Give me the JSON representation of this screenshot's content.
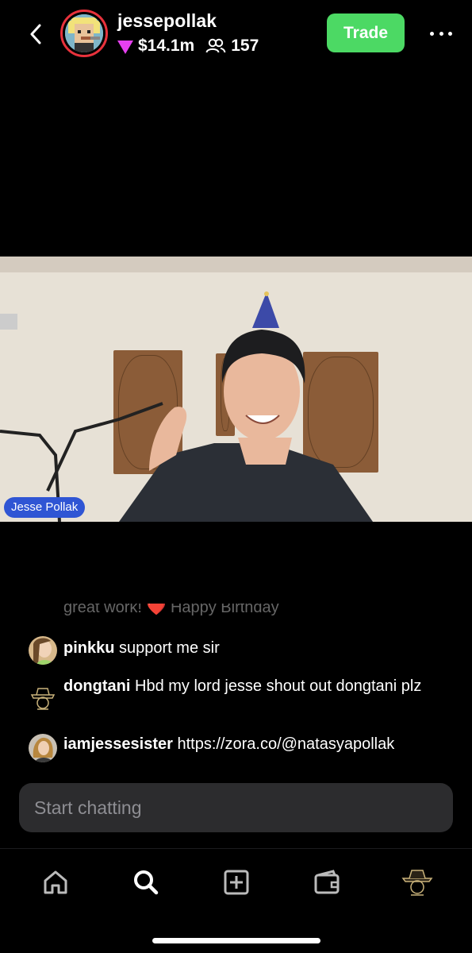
{
  "header": {
    "username": "jessepollak",
    "value": "$14.1m",
    "members": "157",
    "trade_label": "Trade"
  },
  "video": {
    "name_tag": "Jesse Pollak"
  },
  "chat": {
    "faded_text": "great work! ❤️ Happy Birthday",
    "messages": [
      {
        "user": "pinkku",
        "text": "support me sir"
      },
      {
        "user": "dongtani",
        "text": "Hbd my lord jesse shout out dongtani plz"
      },
      {
        "user": "iamjessesister",
        "text": "https://zora.co/@natasyapollak"
      }
    ],
    "input_placeholder": "Start chatting"
  },
  "tabbar": {
    "items": [
      "home-icon",
      "search-icon",
      "create-icon",
      "wallet-icon",
      "profile-icon"
    ]
  },
  "colors": {
    "trade": "#4cd964",
    "avatar_ring": "#e8323c",
    "value_triangle": "#e640f0",
    "name_tag": "#2f55d4"
  }
}
